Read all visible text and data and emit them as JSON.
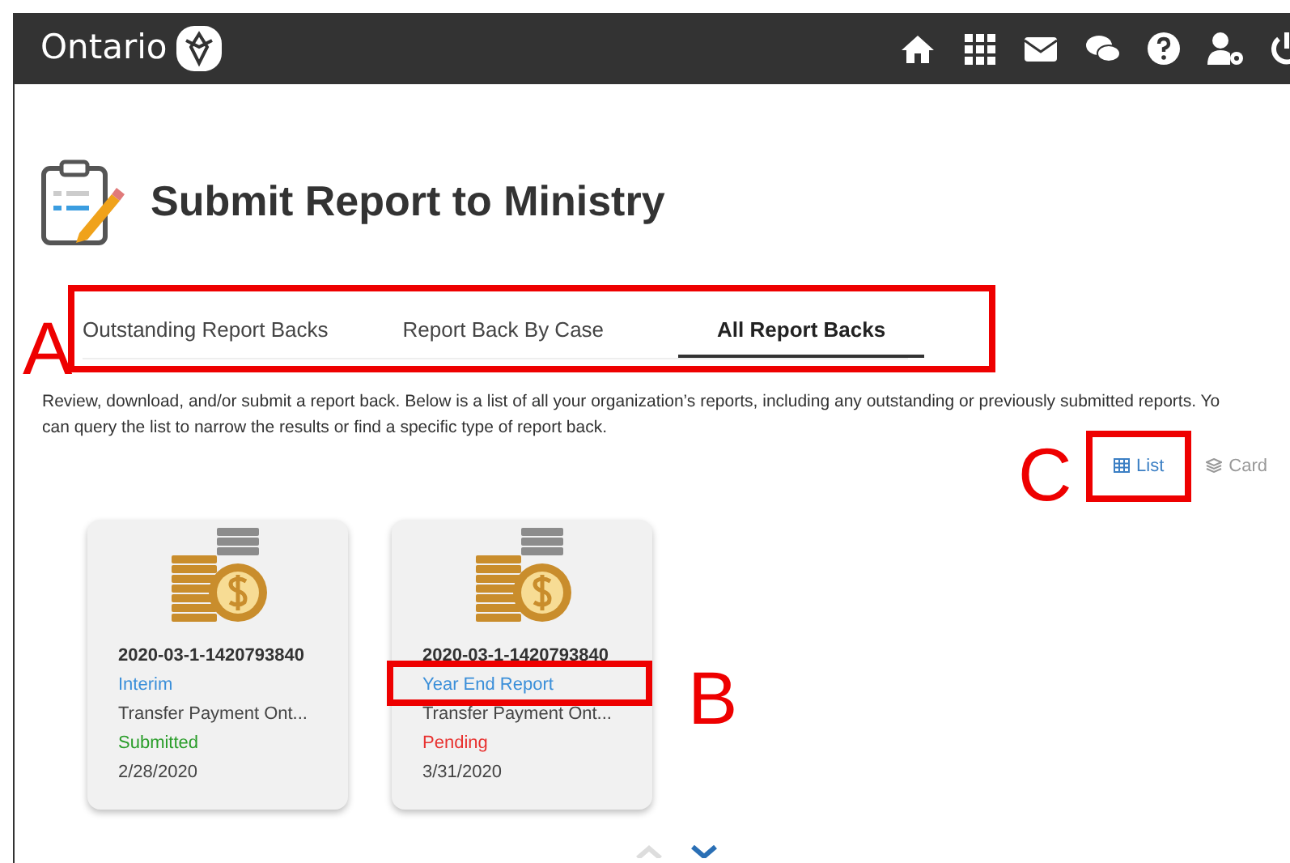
{
  "header": {
    "brand": "Ontario"
  },
  "page": {
    "title": "Submit Report to Ministry"
  },
  "tabs": [
    {
      "label": "Outstanding Report Backs",
      "selected": false
    },
    {
      "label": "Report Back By Case",
      "selected": false
    },
    {
      "label": "All Report Backs",
      "selected": true
    }
  ],
  "description": [
    "Review, download, and/or submit a report back. Below is a list of all your organization’s reports, including any outstanding or previously submitted reports. Yo",
    "can query the list to narrow the results or find a specific type of report back."
  ],
  "view_toggle": [
    {
      "label": "List",
      "selected": true
    },
    {
      "label": "Card",
      "selected": false
    }
  ],
  "cards": [
    {
      "id": "2020-03-1-1420793840",
      "type": "Interim",
      "organization": "Transfer Payment Ont...",
      "status": "Submitted",
      "color": "#2a9d2a",
      "date": "2/28/2020"
    },
    {
      "id": "2020-03-1-1420793840",
      "type": "Year End Report",
      "organization": "Transfer Payment Ont...",
      "status": "Pending",
      "color": "#e8312f",
      "date": "3/31/2020"
    }
  ],
  "annotations": [
    {
      "letter": "A"
    },
    {
      "letter": "B"
    },
    {
      "letter": "C"
    }
  ]
}
